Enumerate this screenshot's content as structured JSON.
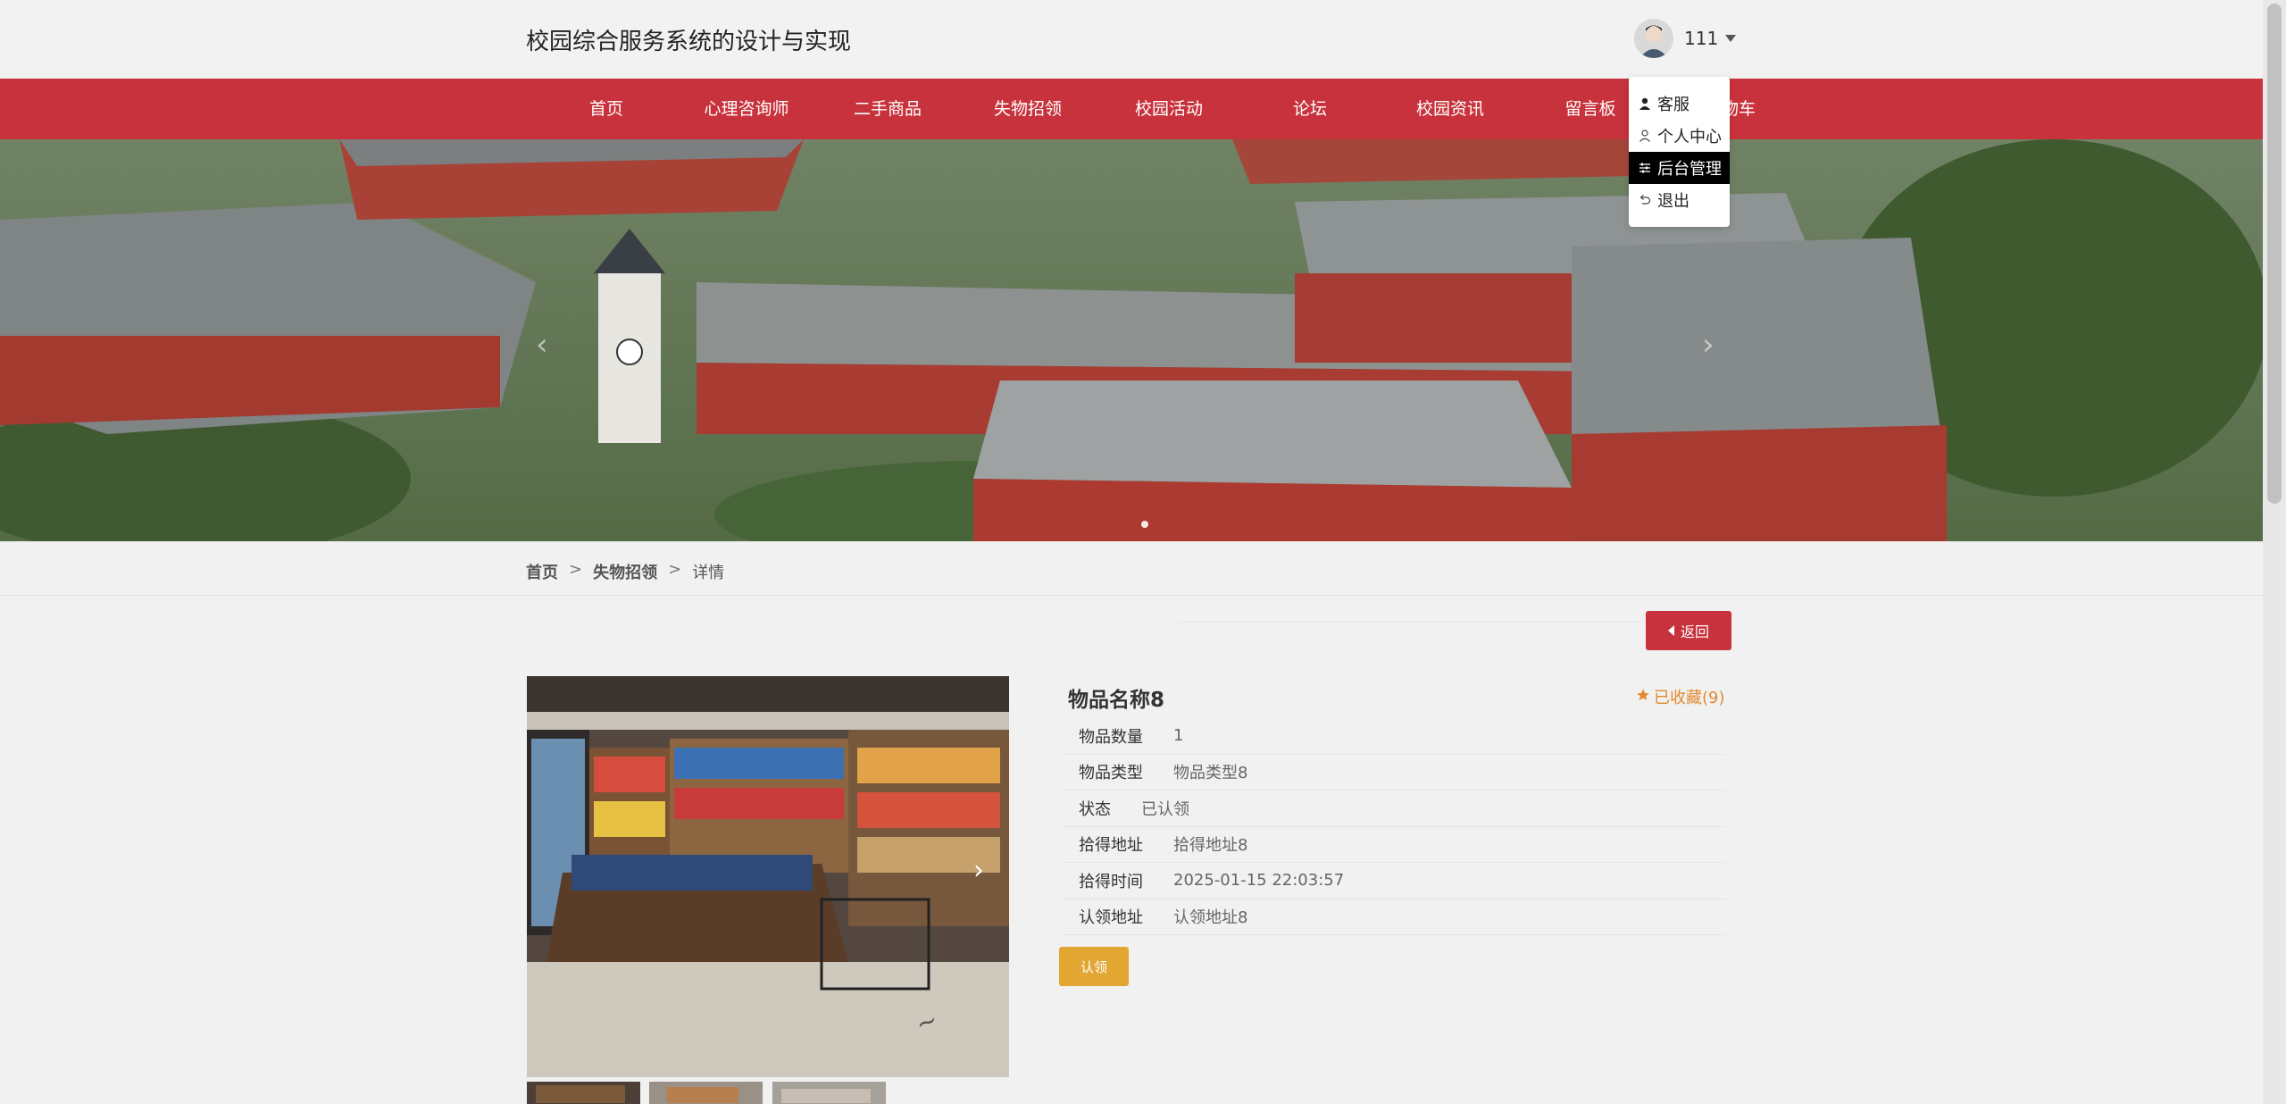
{
  "header": {
    "site_title": "校园综合服务系统的设计与实现",
    "username": "111"
  },
  "nav": {
    "items": [
      {
        "label": "首页"
      },
      {
        "label": "心理咨询师"
      },
      {
        "label": "二手商品"
      },
      {
        "label": "失物招领"
      },
      {
        "label": "校园活动"
      },
      {
        "label": "论坛"
      },
      {
        "label": "校园资讯"
      },
      {
        "label": "留言板"
      },
      {
        "label": "物车"
      }
    ]
  },
  "user_menu": {
    "items": [
      {
        "label": "客服",
        "icon": "user-solid-icon"
      },
      {
        "label": "个人中心",
        "icon": "user-outline-icon"
      },
      {
        "label": "后台管理",
        "icon": "sliders-icon",
        "active": true
      },
      {
        "label": "退出",
        "icon": "undo-icon"
      }
    ]
  },
  "breadcrumb": {
    "home": "首页",
    "sep1": ">",
    "section": "失物招领",
    "sep2": ">",
    "current": "详情"
  },
  "back_button": {
    "label": "返回",
    "icon": "caret-left-icon"
  },
  "item": {
    "title": "物品名称8",
    "favorite_label": "已收藏(9)",
    "favorite_icon": "star-icon",
    "fields": [
      {
        "key": "物品数量",
        "value": "1"
      },
      {
        "key": "物品类型",
        "value": "物品类型8"
      },
      {
        "key": "状态",
        "value": "已认领"
      },
      {
        "key": "拾得地址",
        "value": "拾得地址8"
      },
      {
        "key": "拾得时间",
        "value": "2025-01-15 22:03:57"
      },
      {
        "key": "认领地址",
        "value": "认领地址8"
      }
    ],
    "claim_button": "认领"
  },
  "colors": {
    "primary_red": "#c8323c",
    "accent_orange": "#e2a633",
    "favorite_orange": "#e2892c"
  }
}
